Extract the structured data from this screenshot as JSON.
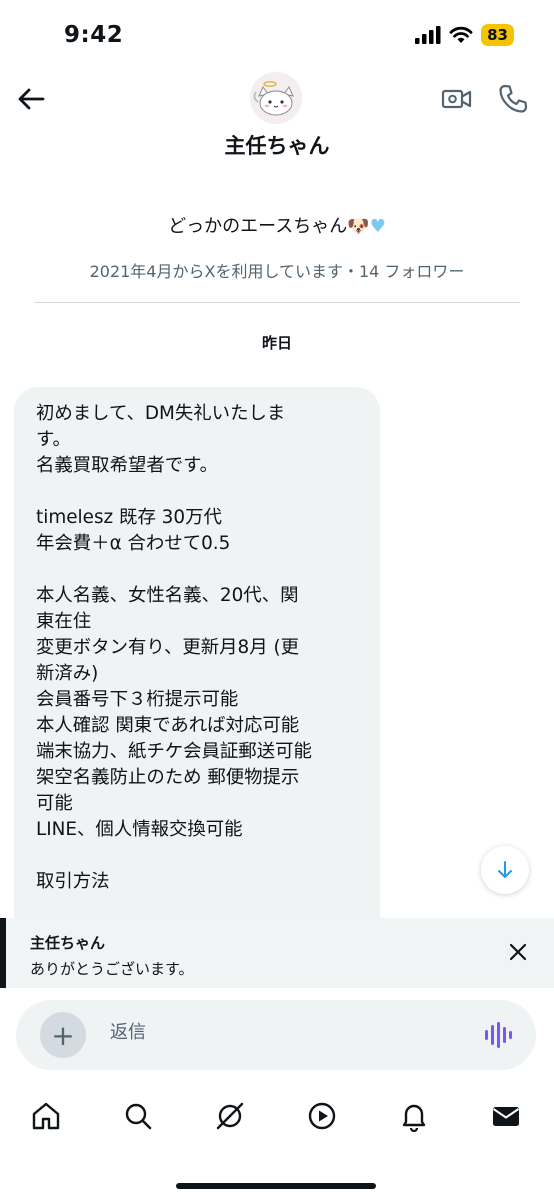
{
  "status": {
    "time": "9:42",
    "battery": "83",
    "battery_color": "#f5c400"
  },
  "header": {
    "name": "主任ちゃん",
    "avatar_icon": "angel-cat-avatar"
  },
  "profile": {
    "handle_text": "どっかのエースちゃん",
    "handle_emoji": "🐶",
    "handle_heart": "♥",
    "meta": "2021年4月からXを利用しています・14 フォロワー"
  },
  "date_separator": "昨日",
  "message": {
    "lines": [
      "初めまして、DM失礼いたしま",
      "す。",
      "名義買取希望者です。",
      "",
      "timelesz 既存 30万代",
      "年会費＋α 合わせて0.5",
      "",
      "本人名義、女性名義、20代、関",
      "東在住",
      "変更ボタン有り、更新月8月 (更",
      "新済み)",
      "会員番号下３桁提示可能",
      "本人確認 関東であれば対応可能",
      "端末協力、紙チケ会員証郵送可能",
      "架空名義防止のため 郵便物提示",
      "可能",
      "LINE、個人情報交換可能",
      "",
      "取引方法"
    ]
  },
  "notification": {
    "title": "主任ちゃん",
    "text": "ありがとうございます。"
  },
  "composer": {
    "placeholder": "返信",
    "plus": "+",
    "voice_color": "#7856ff"
  },
  "tabs": [
    "home",
    "search",
    "grok",
    "video",
    "notifications",
    "messages"
  ]
}
